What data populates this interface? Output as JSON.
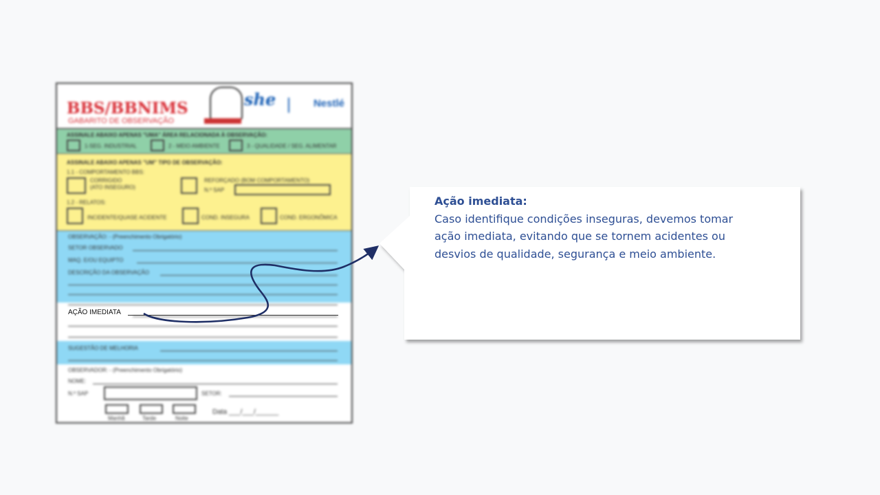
{
  "callout": {
    "title": "Ação imediata:",
    "lines": [
      "Caso identifique condições inseguras, devemos tomar",
      "ação imediata, evitando que se tornem acidentes ou",
      "desvios de qualidade, segurança e meio ambiente."
    ]
  },
  "form": {
    "title": "BBS/BBNIMS",
    "subtitle": "GABARITO DE OBSERVAÇÃO",
    "logo_text": "she",
    "brand": "Nestlé",
    "green_header": "ASSINALE ABAIXO APENAS \"UMA\" ÁREA RELACIONADA À OBSERVAÇÃO:",
    "green_options": [
      "1-SEG. INDUSTRIAL",
      "2 - MEIO AMBIENTE",
      "3 - QUALIDADE / SEG. ALIMENTAR"
    ],
    "yellow_header": "ASSINALE ABAIXO APENAS \"UM\" TIPO DE OBSERVAÇÃO:",
    "yellow_sub1": "1.1 - COMPORTAMENTO BBS:",
    "corrigido": "CORRIGIDO",
    "corrigido2": "(ATO INSEGURO)",
    "reforcado": "REFORÇADO (BOM COMPORTAMENTO)",
    "nsap": "N.º SAP",
    "yellow_sub2": "1.2 - RELATOS:",
    "relatos": [
      "INCIDENTE/QUASE ACIDENTE",
      "COND. INSEGURA",
      "COND. ERGONÔMICA"
    ],
    "observacao": "OBSERVAÇÃO: - (Preenchimento Obrigatório)",
    "setor_obs": "SETOR OBSERVADO",
    "maq": "MAQ. E/OU EQUIPTO",
    "descricao": "DESCRIÇÃO DA OBSERVAÇÃO",
    "acao": "AÇÃO IMEDIATA",
    "sugestao": "SUGESTÃO DE MELHORIA",
    "observador": "OBSERVADOR: - (Preenchimento Obrigatório)",
    "nome": "NOME:",
    "setor": "SETOR:",
    "turnos": [
      "Manhã",
      "Tarde",
      "Noite"
    ],
    "data": "Data ___/___/______"
  }
}
